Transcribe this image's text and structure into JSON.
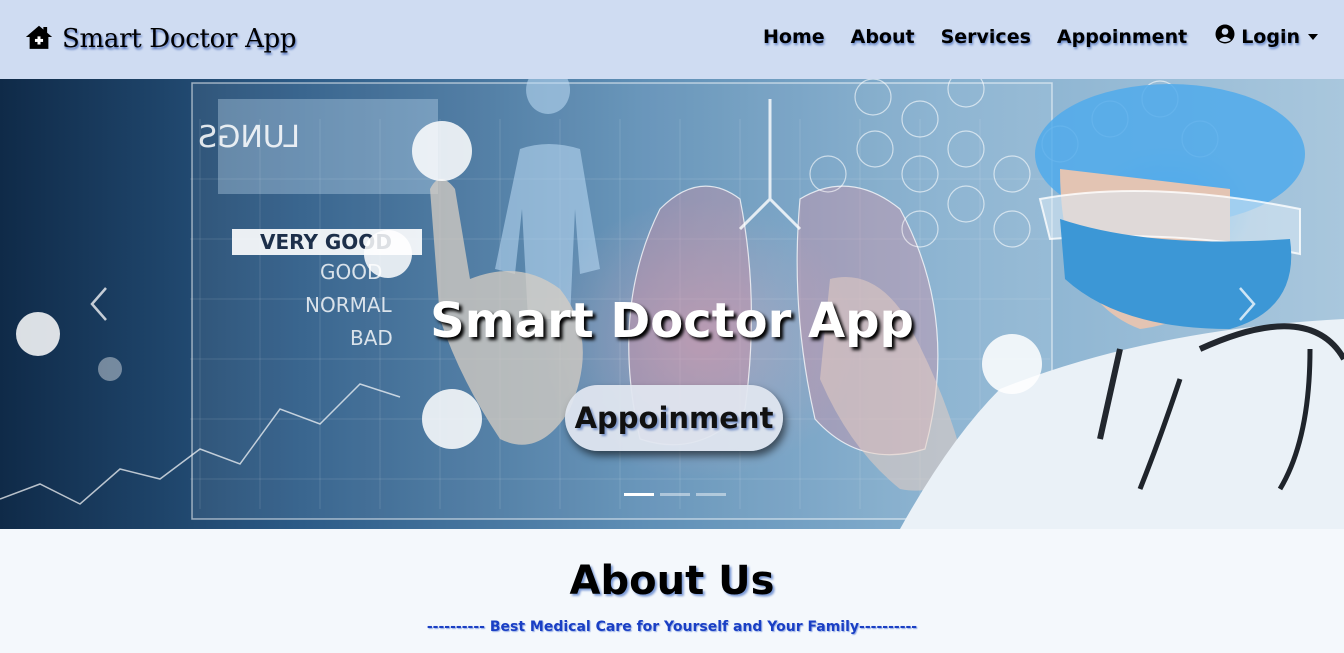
{
  "navbar": {
    "brand": "Smart Doctor App",
    "brand_icon": "home-icon",
    "links": [
      "Home",
      "About",
      "Services",
      "Appoinment"
    ],
    "login": "Login",
    "login_icon": "user-circle-icon"
  },
  "hero": {
    "title": "Smart Doctor App",
    "button": "Appoinment",
    "slides": 3,
    "active_slide": 1,
    "image_text": [
      "LUNGS",
      "VERY GOOD",
      "GOOD",
      "NORMAL",
      "BAD"
    ]
  },
  "about": {
    "title": "About Us",
    "subtitle": "---------- Best Medical Care for Yourself and Your Family----------"
  },
  "colors": {
    "navbar_bg": "#cfdcf2",
    "subtitle": "#1a3fc4",
    "page_bg": "#f4f8fc"
  }
}
